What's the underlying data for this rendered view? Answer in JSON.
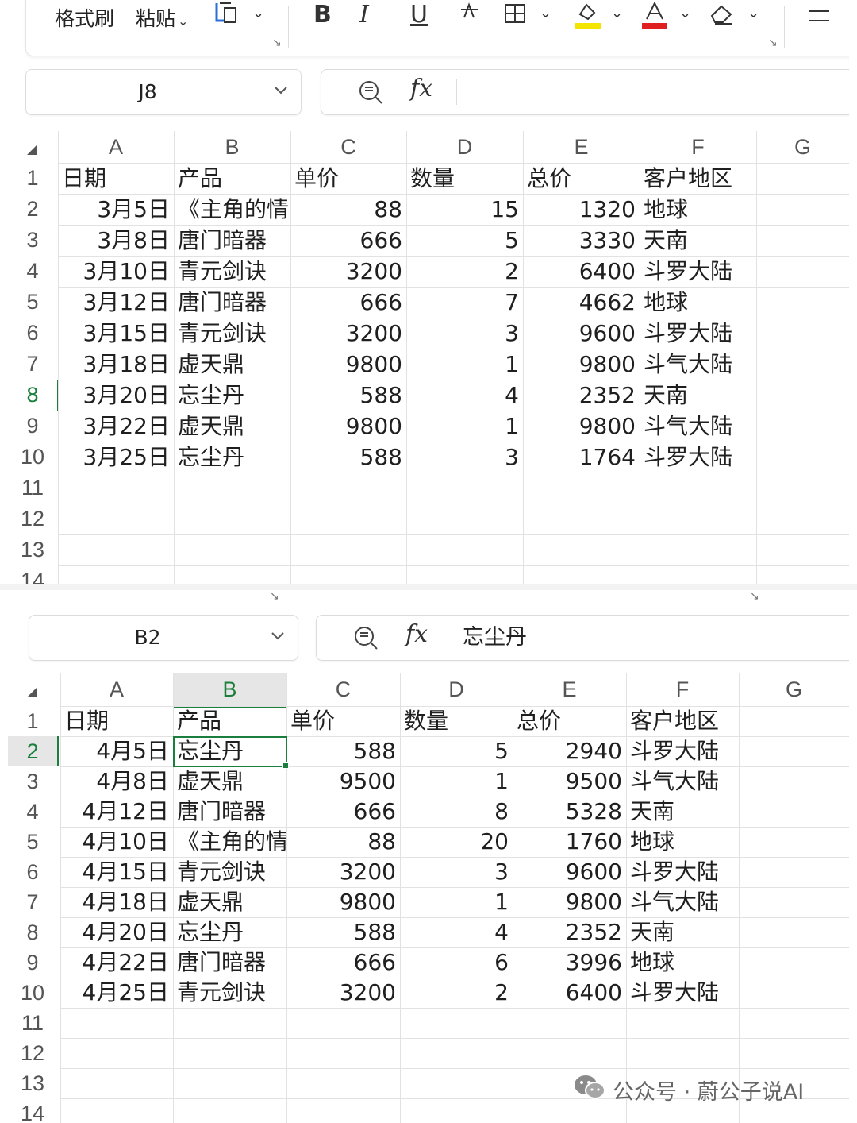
{
  "ribbon": {
    "format_painter": "格式刷",
    "paste": "粘贴",
    "bold_label": "B",
    "italic_label": "I",
    "underline_label": "U",
    "strike_label": "A",
    "font_color_label": "A",
    "highlight_color": "#f3e500",
    "font_color": "#e02020"
  },
  "sheet1": {
    "name_box": "J8",
    "formula_fx": "fx",
    "formula_content": "",
    "columns": [
      "A",
      "B",
      "C",
      "D",
      "E",
      "F",
      "G"
    ],
    "rows": [
      [
        "日期",
        "产品",
        "单价",
        "数量",
        "总价",
        "客户地区"
      ],
      [
        "3月5日",
        "《主角的情",
        "88",
        "15",
        "1320",
        "地球"
      ],
      [
        "3月8日",
        "唐门暗器",
        "666",
        "5",
        "3330",
        "天南"
      ],
      [
        "3月10日",
        "青元剑诀",
        "3200",
        "2",
        "6400",
        "斗罗大陆"
      ],
      [
        "3月12日",
        "唐门暗器",
        "666",
        "7",
        "4662",
        "地球"
      ],
      [
        "3月15日",
        "青元剑诀",
        "3200",
        "3",
        "9600",
        "斗罗大陆"
      ],
      [
        "3月18日",
        "虚天鼎",
        "9800",
        "1",
        "9800",
        "斗气大陆"
      ],
      [
        "3月20日",
        "忘尘丹",
        "588",
        "4",
        "2352",
        "天南"
      ],
      [
        "3月22日",
        "虚天鼎",
        "9800",
        "1",
        "9800",
        "斗气大陆"
      ],
      [
        "3月25日",
        "忘尘丹",
        "588",
        "3",
        "1764",
        "斗罗大陆"
      ]
    ],
    "row_numbers": [
      "1",
      "2",
      "3",
      "4",
      "5",
      "6",
      "7",
      "8",
      "9",
      "10",
      "11",
      "12",
      "13",
      "14"
    ],
    "selected_row": "8"
  },
  "sheet2": {
    "name_box": "B2",
    "formula_fx": "fx",
    "formula_content": "忘尘丹",
    "columns": [
      "A",
      "B",
      "C",
      "D",
      "E",
      "F",
      "G"
    ],
    "rows": [
      [
        "日期",
        "产品",
        "单价",
        "数量",
        "总价",
        "客户地区"
      ],
      [
        "4月5日",
        "忘尘丹",
        "588",
        "5",
        "2940",
        "斗罗大陆"
      ],
      [
        "4月8日",
        "虚天鼎",
        "9500",
        "1",
        "9500",
        "斗气大陆"
      ],
      [
        "4月12日",
        "唐门暗器",
        "666",
        "8",
        "5328",
        "天南"
      ],
      [
        "4月10日",
        "《主角的情",
        "88",
        "20",
        "1760",
        "地球"
      ],
      [
        "4月15日",
        "青元剑诀",
        "3200",
        "3",
        "9600",
        "斗罗大陆"
      ],
      [
        "4月18日",
        "虚天鼎",
        "9800",
        "1",
        "9800",
        "斗气大陆"
      ],
      [
        "4月20日",
        "忘尘丹",
        "588",
        "4",
        "2352",
        "天南"
      ],
      [
        "4月22日",
        "唐门暗器",
        "666",
        "6",
        "3996",
        "地球"
      ],
      [
        "4月25日",
        "青元剑诀",
        "3200",
        "2",
        "6400",
        "斗罗大陆"
      ]
    ],
    "row_numbers": [
      "1",
      "2",
      "3",
      "4",
      "5",
      "6",
      "7",
      "8",
      "9",
      "10",
      "11",
      "12",
      "13",
      "14"
    ],
    "selected_row": "2",
    "selected_col": "B"
  },
  "watermark": {
    "text": "公众号 · 蔚公子说AI"
  },
  "colors": {
    "accent": "#1a7f3c",
    "gridline": "#e2e2e2",
    "header_text": "#555555"
  }
}
